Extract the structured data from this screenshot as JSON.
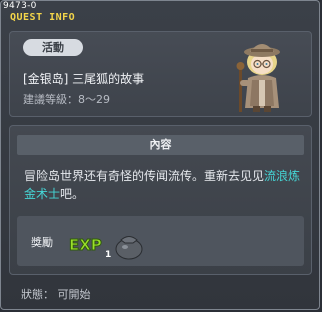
{
  "window": {
    "quest_id": "9473-0",
    "title": "QUEST INFO"
  },
  "header": {
    "category": "活動",
    "quest_name": "[金银岛] 三尾狐的故事",
    "level_requirement": "建議等級：8～29"
  },
  "content": {
    "section_title": "內容",
    "description_before": "冒险岛世界还有奇怪的传闻流传。重新去见见",
    "description_highlight": "流浪炼金术士",
    "description_after": "吧。",
    "reward": {
      "label": "獎勵",
      "type_text": "EXP",
      "item_count": "1",
      "icon": "coin-bag-icon"
    }
  },
  "status": {
    "text": "狀態： 可開始"
  },
  "colors": {
    "title": "#f3d54a",
    "highlight": "#45d6d6",
    "exp_green": "#9be02b"
  }
}
